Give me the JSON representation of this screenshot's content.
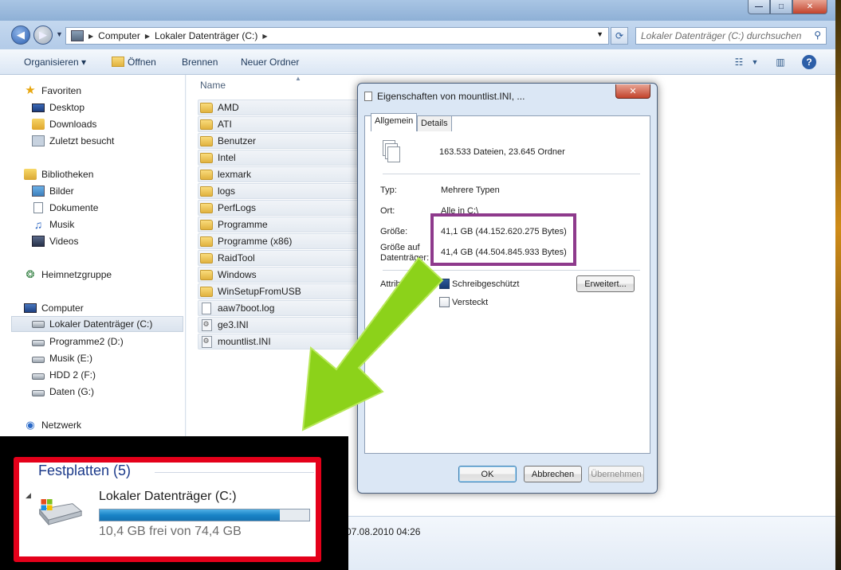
{
  "window": {
    "close_glyph": "✕",
    "max_glyph": "□",
    "min_glyph": "—"
  },
  "address": {
    "crumbs": [
      "Computer",
      "Lokaler Datenträger (C:)"
    ],
    "search_placeholder": "Lokaler Datenträger (C:) durchsuchen"
  },
  "toolbar": {
    "organize": "Organisieren ▾",
    "open": "Öffnen",
    "burn": "Brennen",
    "new_folder": "Neuer Ordner"
  },
  "nav": {
    "favorites": "Favoriten",
    "desktop": "Desktop",
    "downloads": "Downloads",
    "recent": "Zuletzt besucht",
    "libraries": "Bibliotheken",
    "pictures": "Bilder",
    "documents": "Dokumente",
    "music": "Musik",
    "videos": "Videos",
    "homegroup": "Heimnetzgruppe",
    "computer": "Computer",
    "drives": [
      "Lokaler Datenträger (C:)",
      "Programme2 (D:)",
      "Musik (E:)",
      "HDD 2 (F:)",
      "Daten (G:)"
    ],
    "network": "Netzwerk"
  },
  "files": {
    "col_name": "Name",
    "items": [
      "AMD",
      "ATI",
      "Benutzer",
      "Intel",
      "lexmark",
      "logs",
      "PerfLogs",
      "Programme",
      "Programme (x86)",
      "RaidTool",
      "Windows",
      "WinSetupFromUSB",
      "aaw7boot.log",
      "ge3.INI",
      "mountlist.INI"
    ]
  },
  "details": {
    "date": "07.08.2010 04:26"
  },
  "dialog": {
    "title": "Eigenschaften von mountlist.INI, ...",
    "close_glyph": "✕",
    "tabs": [
      "Allgemein",
      "Details"
    ],
    "summary": "163.533 Dateien, 23.645 Ordner",
    "type_label": "Typ:",
    "type_value": "Mehrere Typen",
    "location_label": "Ort:",
    "location_value": "Alle in C:\\",
    "size_label": "Größe:",
    "size_value": "41,1 GB (44.152.620.275 Bytes)",
    "disk_size_label_1": "Größe auf",
    "disk_size_label_2": "Datenträger:",
    "disk_size_value": "41,4 GB (44.504.845.933 Bytes)",
    "attr_label": "Attribute:",
    "readonly": "Schreibgeschützt",
    "hidden": "Versteckt",
    "advanced": "Erweitert...",
    "ok": "OK",
    "cancel": "Abbrechen",
    "apply": "Übernehmen"
  },
  "overlay": {
    "group_title": "Festplatten (5)",
    "drive_name": "Lokaler Datenträger (C:)",
    "drive_free": "10,4 GB frei von 74,4 GB",
    "used_fraction": 0.86
  },
  "colors": {
    "highlight": "#8e3a8c",
    "redbox": "#e4001a",
    "arrow": "#8cd21a"
  }
}
